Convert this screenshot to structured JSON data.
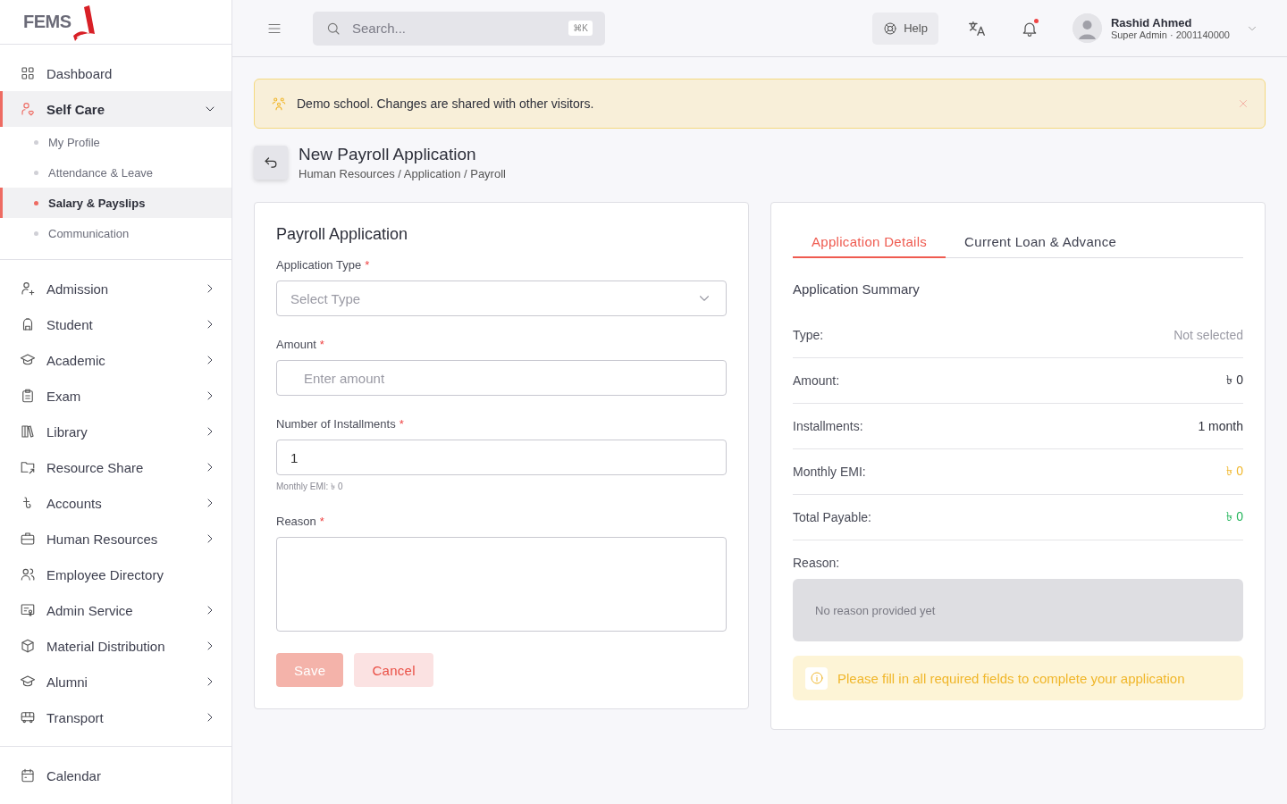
{
  "logo": {
    "text": "FEMS"
  },
  "sidebar": {
    "sections": [
      [
        {
          "label": "Dashboard",
          "has_submenu": false,
          "selected": false
        },
        {
          "label": "Self Care",
          "has_submenu": true,
          "expanded": true,
          "selected": true,
          "children": [
            {
              "label": "My Profile",
              "selected": false
            },
            {
              "label": "Attendance & Leave",
              "selected": false
            },
            {
              "label": "Salary & Payslips",
              "selected": true
            },
            {
              "label": "Communication",
              "selected": false
            }
          ]
        }
      ],
      [
        {
          "label": "Admission",
          "has_submenu": true,
          "expanded": false,
          "selected": false
        },
        {
          "label": "Student",
          "has_submenu": true,
          "expanded": false,
          "selected": false
        },
        {
          "label": "Academic",
          "has_submenu": true,
          "expanded": false,
          "selected": false
        },
        {
          "label": "Exam",
          "has_submenu": true,
          "expanded": false,
          "selected": false
        },
        {
          "label": "Library",
          "has_submenu": true,
          "expanded": false,
          "selected": false
        },
        {
          "label": "Resource Share",
          "has_submenu": true,
          "expanded": false,
          "selected": false
        },
        {
          "label": "Accounts",
          "has_submenu": true,
          "expanded": false,
          "selected": false
        },
        {
          "label": "Human Resources",
          "has_submenu": true,
          "expanded": false,
          "selected": false
        },
        {
          "label": "Employee Directory",
          "has_submenu": false,
          "selected": false
        },
        {
          "label": "Admin Service",
          "has_submenu": true,
          "expanded": false,
          "selected": false
        },
        {
          "label": "Material Distribution",
          "has_submenu": true,
          "expanded": false,
          "selected": false
        },
        {
          "label": "Alumni",
          "has_submenu": true,
          "expanded": false,
          "selected": false
        },
        {
          "label": "Transport",
          "has_submenu": true,
          "expanded": false,
          "selected": false
        }
      ],
      [
        {
          "label": "Calendar",
          "has_submenu": false,
          "selected": false
        }
      ]
    ]
  },
  "topbar": {
    "search": {
      "placeholder": "Search...",
      "shortcut": "⌘K"
    },
    "help": "Help",
    "notifications": {
      "unread": true
    },
    "user": {
      "name": "Rashid Ahmed",
      "role": "Super Admin · 2001140000"
    }
  },
  "banner": {
    "text": "Demo school. Changes are shared with other visitors."
  },
  "page": {
    "title": "New Payroll Application",
    "breadcrumb": "Human Resources / Application / Payroll"
  },
  "form": {
    "title": "Payroll Application",
    "fields": [
      {
        "kind": "select",
        "label": "Application Type",
        "required_mark": "*",
        "placeholder": "Select Type"
      },
      {
        "kind": "text",
        "label": "Amount",
        "required_mark": "*",
        "placeholder": "Enter amount"
      },
      {
        "kind": "text",
        "label": "Number of Installments",
        "required_mark": "*",
        "value": "1",
        "hint": "Monthly EMI: ৳ 0"
      },
      {
        "kind": "textarea",
        "label": "Reason",
        "required_mark": "*"
      }
    ],
    "buttons": [
      {
        "label": "Save",
        "kind": "primary",
        "disabled": true
      },
      {
        "label": "Cancel",
        "kind": "secondary",
        "disabled": false
      }
    ]
  },
  "details": {
    "tabs": [
      {
        "label": "Application Details",
        "selected": true
      },
      {
        "label": "Current Loan & Advance",
        "selected": false
      }
    ],
    "summary_title": "Application Summary",
    "rows": [
      {
        "label": "Type:",
        "value": "Not selected",
        "color": "#9a9aa4"
      },
      {
        "label": "Amount:",
        "value": "৳ 0",
        "color": "#2d2f3a"
      },
      {
        "label": "Installments:",
        "value": "1 month",
        "color": "#2d2f3a"
      },
      {
        "label": "Monthly EMI:",
        "value": "৳ 0",
        "color": "#f0b62a"
      },
      {
        "label": "Total Payable:",
        "value": "৳ 0",
        "color": "#22b55a"
      }
    ],
    "reason_label": "Reason:",
    "reason_value": "No reason provided yet",
    "notice": "Please fill in all required fields to complete your application"
  }
}
